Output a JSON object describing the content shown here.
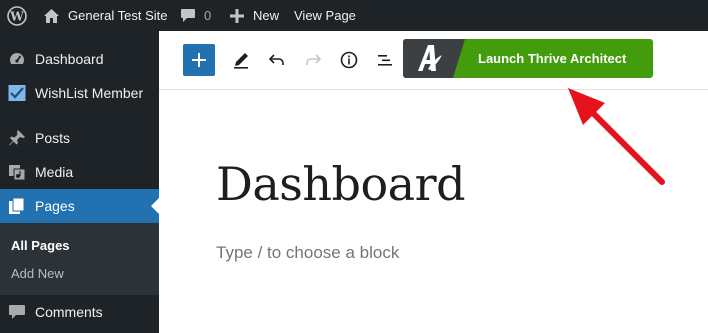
{
  "admin_bar": {
    "site_name": "General Test Site",
    "comments_count": "0",
    "new_label": "New",
    "view_page_label": "View Page"
  },
  "sidebar": {
    "items": [
      {
        "label": "Dashboard",
        "icon": "dashboard-icon"
      },
      {
        "label": "WishList Member",
        "icon": "wishlist-check-icon"
      },
      {
        "label": "Posts",
        "icon": "pushpin-icon"
      },
      {
        "label": "Media",
        "icon": "media-icon"
      },
      {
        "label": "Pages",
        "icon": "pages-icon",
        "current": true
      },
      {
        "label": "Comments",
        "icon": "comment-icon"
      }
    ],
    "submenu": [
      "All Pages",
      "Add New"
    ]
  },
  "editor": {
    "toolbar": {
      "add_block": "plus-icon",
      "tools": "pencil-icon",
      "undo": "undo-icon",
      "redo": "redo-icon",
      "details": "info-icon",
      "list_view": "list-view-icon"
    },
    "thrive_button_label": "Launch Thrive Architect",
    "page_title": "Dashboard",
    "block_placeholder": "Type / to choose a block"
  },
  "colors": {
    "admin_dark": "#1d2327",
    "wp_blue": "#2271b1",
    "thrive_green": "#439c0c",
    "thrive_logo_bg": "#3d4043",
    "annotation_arrow": "#e5131c"
  }
}
